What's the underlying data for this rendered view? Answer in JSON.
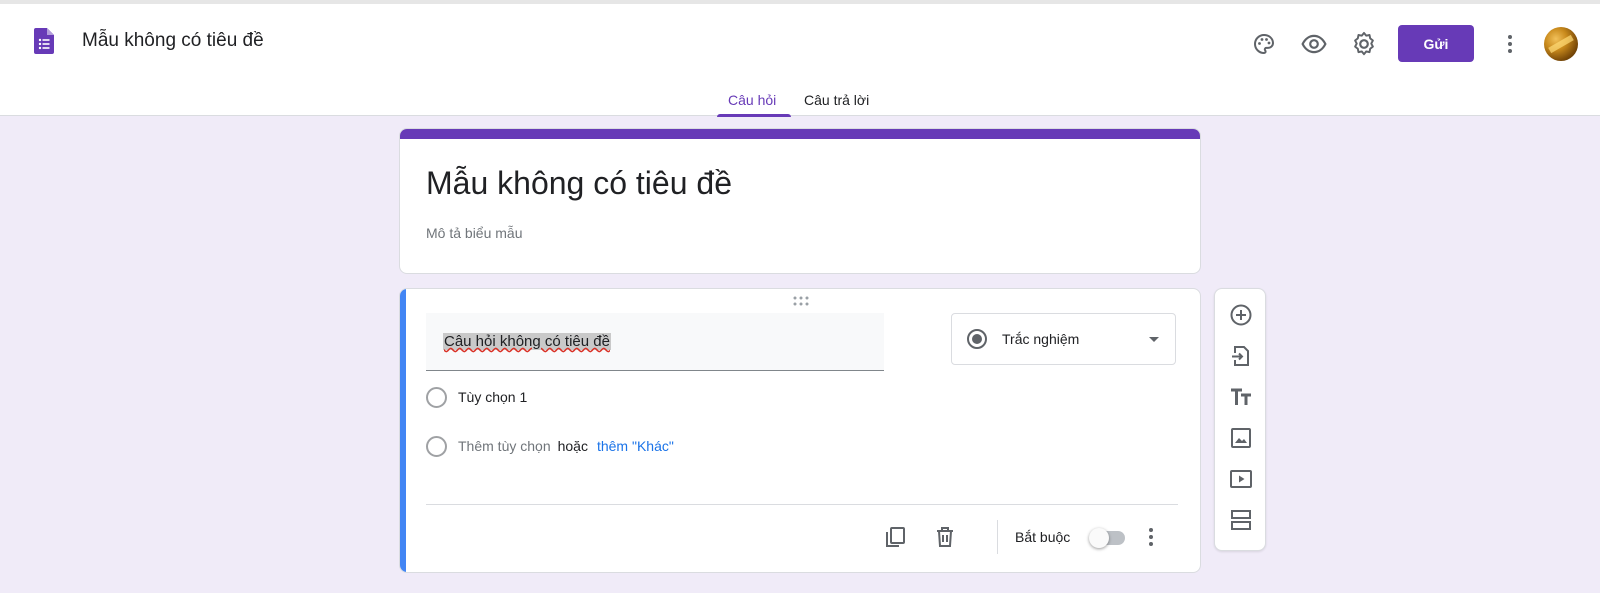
{
  "header": {
    "doc_title": "Mẫu không có tiêu đề",
    "send_label": "Gửi",
    "icons": [
      "palette-icon",
      "preview-icon",
      "settings-icon",
      "more-vert-icon"
    ]
  },
  "tabs": [
    {
      "label": "Câu hỏi",
      "active": true
    },
    {
      "label": "Câu trả lời",
      "active": false
    }
  ],
  "form": {
    "title": "Mẫu không có tiêu đề",
    "description_placeholder": "Mô tả biểu mẫu",
    "accent_color": "#673ab7"
  },
  "question": {
    "title": "Câu hỏi không có tiêu đề",
    "type": "Trắc nghiệm",
    "options": [
      "Tùy chọn 1"
    ],
    "add_option": "Thêm tùy chọn",
    "or_text": "hoặc",
    "add_other": "thêm \"Khác\"",
    "required_label": "Bắt buộc",
    "required": false,
    "active_color": "#4285f4"
  },
  "side_toolbar": [
    "add-question-icon",
    "import-questions-icon",
    "add-title-icon",
    "add-image-icon",
    "add-video-icon",
    "add-section-icon"
  ]
}
